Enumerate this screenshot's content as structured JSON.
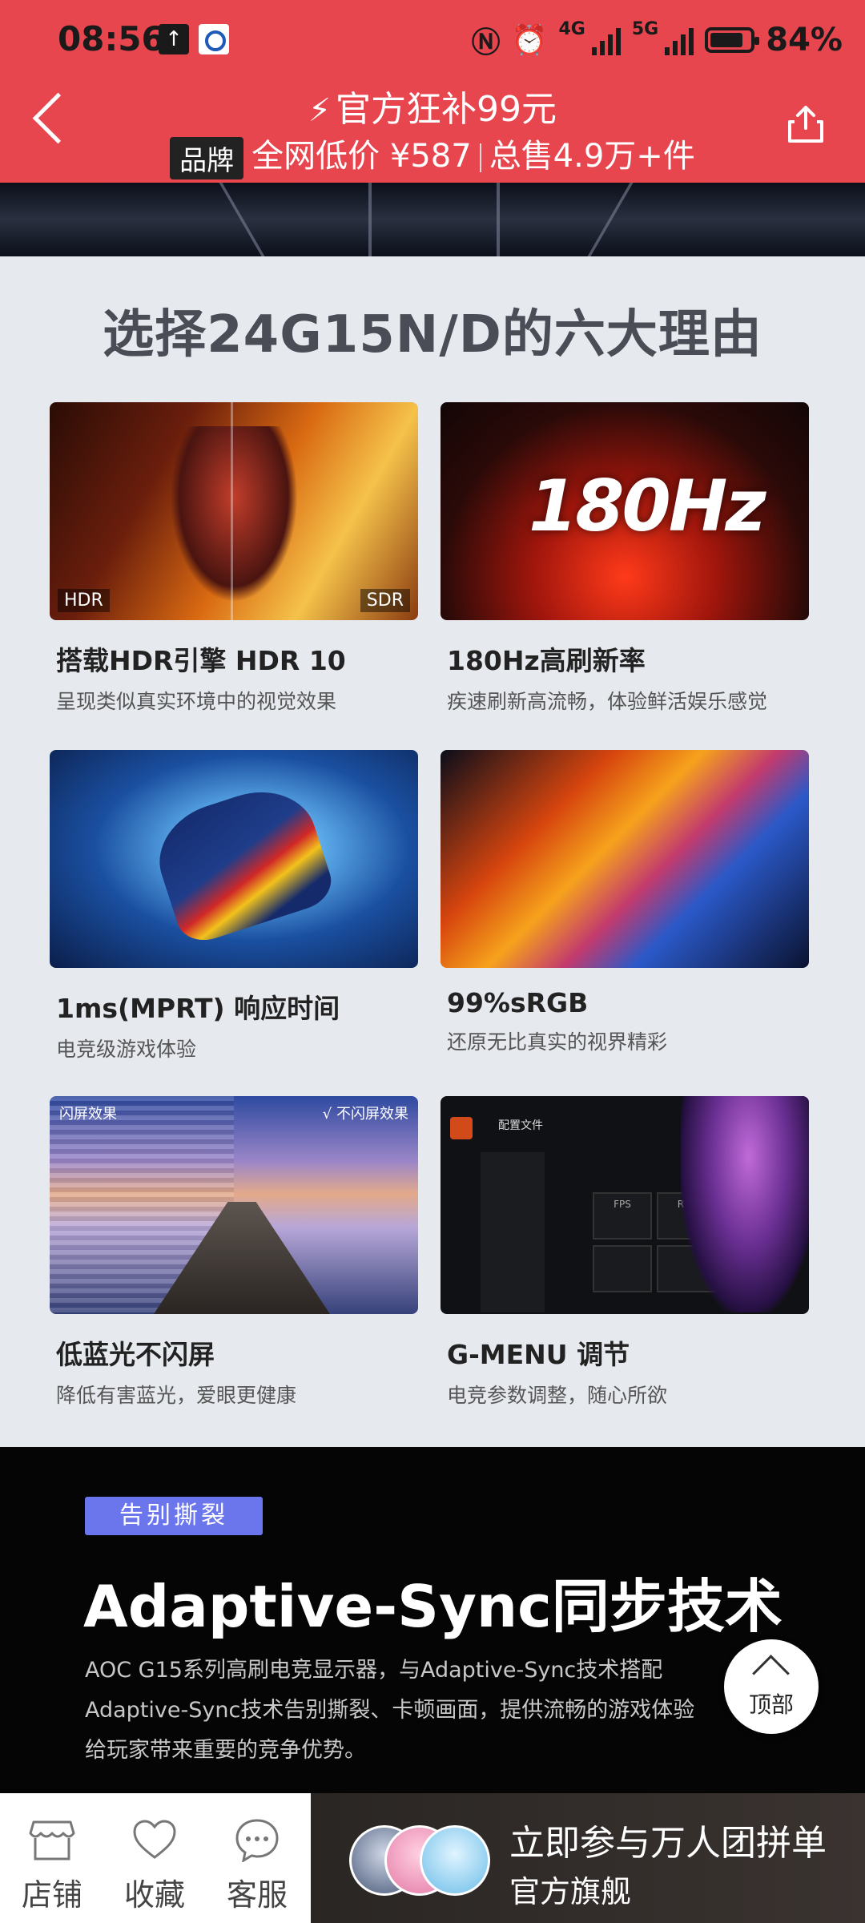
{
  "status_bar": {
    "time": "08:56",
    "network_1": "4G",
    "network_2": "5G",
    "battery": "84%",
    "battery_level": 0.84
  },
  "header": {
    "promo": "官方狂补99元",
    "brand_tag": "品牌",
    "low_price": "全网低价 ¥587",
    "total_sold": "总售4.9万+件"
  },
  "reasons": {
    "title": "选择24G15N/D的六大理由",
    "items": [
      {
        "title": "搭载HDR引擎 HDR 10",
        "subtitle": "呈现类似真实环境中的视觉效果",
        "badge_left": "HDR",
        "badge_right": "SDR"
      },
      {
        "title": "180Hz高刷新率",
        "subtitle": "疾速刷新高流畅，体验鲜活娱乐感觉",
        "image_text": "180Hz"
      },
      {
        "title": "1ms(MPRT) 响应时间",
        "subtitle": "电竞级游戏体验"
      },
      {
        "title": "99%sRGB",
        "subtitle": "还原无比真实的视界精彩"
      },
      {
        "title": "低蓝光不闪屏",
        "subtitle": "降低有害蓝光，爱眼更健康",
        "label_left": "闪屏效果",
        "label_right": "√ 不闪屏效果"
      },
      {
        "title": "G-MENU 调节",
        "subtitle": "电竞参数调整，随心所欲",
        "menu_header": "配置文件",
        "menu_box_1": "FPS",
        "menu_box_2": "RTS"
      }
    ]
  },
  "sync": {
    "tag": "告别撕裂",
    "heading": "Adaptive-Sync同步技术",
    "line1": "AOC G15系列高刷电竞显示器，与Adaptive-Sync技术搭配",
    "line2": "Adaptive-Sync技术告别撕裂、卡顿画面，提供流畅的游戏体验",
    "line3": "给玩家带来重要的竞争优势。"
  },
  "back_to_top": "顶部",
  "bottom_bar": {
    "store": "店铺",
    "favorite": "收藏",
    "service": "客服",
    "group_title": "立即参与万人团拼单",
    "group_subtitle": "官方旗舰"
  },
  "colors": {
    "header_bg": "#e8464f",
    "tag_bg": "#6b76ec"
  }
}
